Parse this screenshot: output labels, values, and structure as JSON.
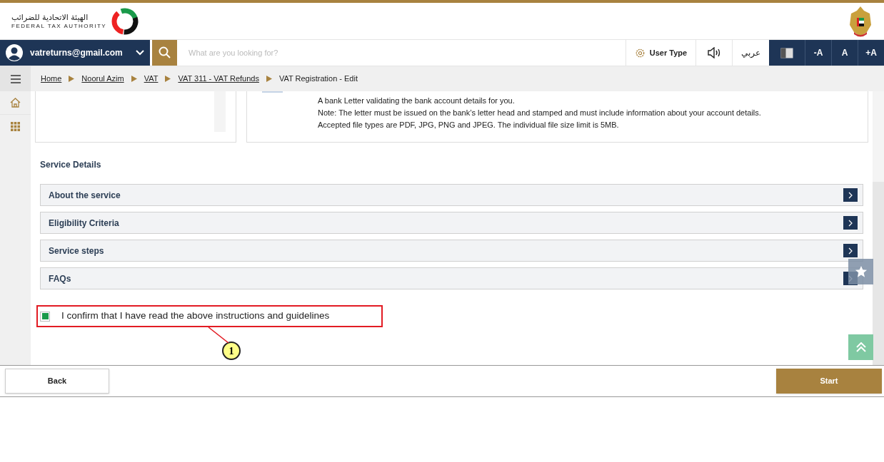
{
  "header": {
    "logo_arabic": "الهيئة الاتحادية للضرائب",
    "logo_english": "FEDERAL TAX AUTHORITY"
  },
  "nav": {
    "account": "vatreturns@gmail.com",
    "search": {
      "placeholder": "What are you looking for?"
    },
    "user_type": "User Type",
    "language": "عربي",
    "font_sizes": [
      "-A",
      "A",
      "+A"
    ]
  },
  "breadcrumb": [
    {
      "label": "Home",
      "link": true
    },
    {
      "label": "Noorul Azim",
      "link": true
    },
    {
      "label": "VAT",
      "link": true
    },
    {
      "label": "VAT 311 - VAT Refunds",
      "link": true
    },
    {
      "label": "VAT Registration - Edit",
      "link": false
    }
  ],
  "document_note": [
    "A bank Letter validating the bank account details for you.",
    "Note: The letter must be issued on the bank’s letter head and stamped and must include information about your account details.",
    "Accepted file types are PDF, JPG, PNG and JPEG. The individual file size limit is 5MB."
  ],
  "service_details": {
    "title": "Service Details",
    "sections": [
      {
        "label": "About the service"
      },
      {
        "label": "Eligibility Criteria"
      },
      {
        "label": "Service steps"
      },
      {
        "label": "FAQs"
      }
    ]
  },
  "confirmation": {
    "label": "I confirm that I have read the above instructions and guidelines",
    "checked": true
  },
  "annotation": {
    "number": "1"
  },
  "footer": {
    "back": "Back",
    "start": "Start"
  }
}
